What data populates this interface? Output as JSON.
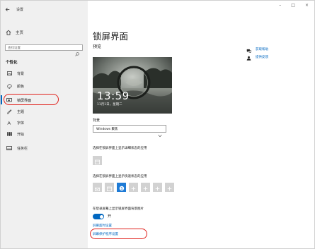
{
  "window": {
    "title": "设置",
    "controls": {
      "minimize": "–",
      "maximize": "□",
      "close": "×"
    }
  },
  "sidebar": {
    "home": "主页",
    "search_placeholder": "查找设置",
    "section": "个性化",
    "items": [
      {
        "label": "背景",
        "icon": "picture-icon"
      },
      {
        "label": "颜色",
        "icon": "palette-icon"
      },
      {
        "label": "锁屏界面",
        "icon": "lock-screen-icon",
        "active": true
      },
      {
        "label": "主题",
        "icon": "brush-icon"
      },
      {
        "label": "字体",
        "icon": "font-icon"
      },
      {
        "label": "开始",
        "icon": "start-icon"
      },
      {
        "label": "任务栏",
        "icon": "taskbar-icon"
      }
    ]
  },
  "main": {
    "title": "锁屏界面",
    "preview_label": "预览",
    "preview_time": "13:59",
    "preview_date": "11月1日，星期二",
    "background_label": "背景",
    "background_value": "Windows 聚焦",
    "detail_app_label": "选择在锁屏界面上显示详细状态的应用",
    "quick_app_label": "选择在锁屏界面上显示快速状态的应用",
    "signin_bg_label": "在登录屏幕上显示锁屏界面背景图片",
    "toggle_state": "开",
    "link_cortana": "屏幕超时设置",
    "link_screensaver": "屏幕保护程序设置"
  },
  "help": {
    "get_help": "获取帮助",
    "feedback": "提供反馈"
  },
  "colors": {
    "accent": "#0067c0",
    "highlight": "#e0201b",
    "sidebar_bg": "#f0f0f0"
  }
}
